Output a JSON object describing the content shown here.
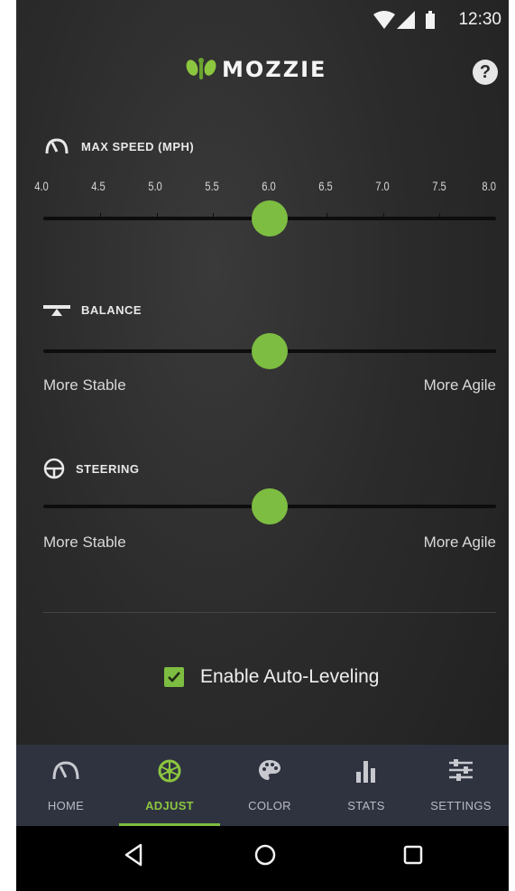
{
  "status_bar": {
    "time": "12:30",
    "icons": [
      "wifi-icon",
      "signal-icon",
      "battery-icon"
    ]
  },
  "header": {
    "logo_text": "MOZZIE",
    "help_label": "?"
  },
  "max_speed": {
    "title": "MAX SPEED (MPH)",
    "ticks": [
      "4.0",
      "4.5",
      "5.0",
      "5.5",
      "6.0",
      "6.5",
      "7.0",
      "7.5",
      "8.0"
    ],
    "min": 4.0,
    "max": 8.0,
    "value": 6.0
  },
  "balance": {
    "title": "BALANCE",
    "left_hint": "More Stable",
    "right_hint": "More Agile",
    "level": 0.5
  },
  "steering": {
    "title": "STEERING",
    "left_hint": "More Stable",
    "right_hint": "More Agile",
    "level": 0.5
  },
  "auto_leveling": {
    "label": "Enable Auto-Leveling",
    "checked": true
  },
  "bottom_nav": {
    "items": [
      {
        "label": "HOME",
        "icon": "speedometer-icon",
        "active": false
      },
      {
        "label": "ADJUST",
        "icon": "wheel-icon",
        "active": true
      },
      {
        "label": "COLOR",
        "icon": "palette-icon",
        "active": false
      },
      {
        "label": "STATS",
        "icon": "bar-chart-icon",
        "active": false
      },
      {
        "label": "SETTINGS",
        "icon": "sliders-icon",
        "active": false
      }
    ]
  },
  "colors": {
    "accent": "#7dbd42",
    "nav_background": "#2f3340",
    "background": "#2b2b2b"
  }
}
